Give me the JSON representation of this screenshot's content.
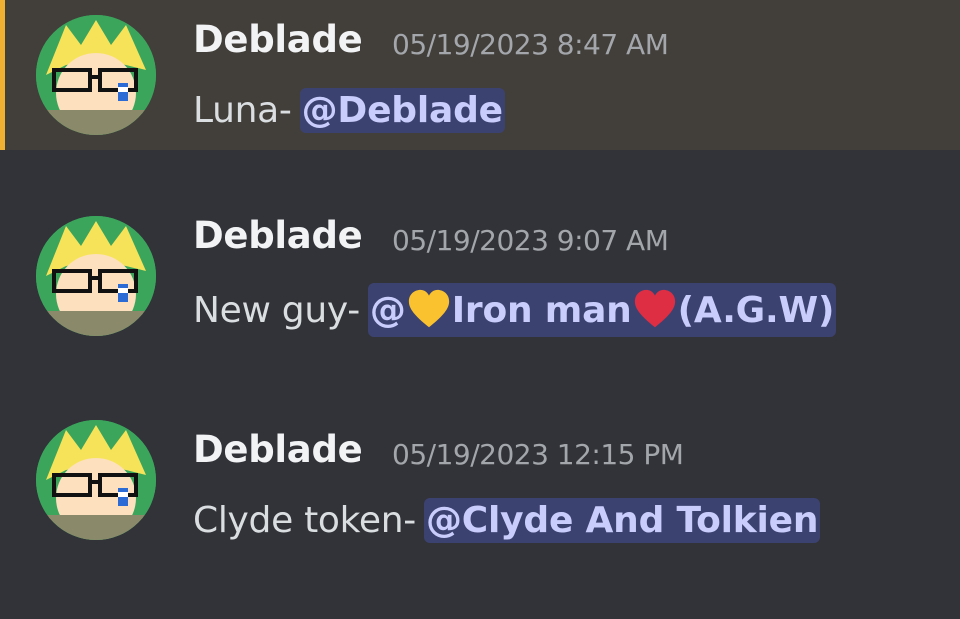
{
  "messages": [
    {
      "username": "Deblade",
      "timestamp": "05/19/2023 8:47 AM",
      "text": "Luna-",
      "mention": {
        "prefix": "@Deblade",
        "name": "",
        "suffix": ""
      },
      "highlighted": true
    },
    {
      "username": "Deblade",
      "timestamp": "05/19/2023 9:07 AM",
      "text": "New guy-",
      "mention": {
        "prefix": "@",
        "name": "Iron man",
        "suffix": "(A.G.W)",
        "emoji_before": "yellow-heart-icon",
        "emoji_after": "red-heart-icon"
      },
      "highlighted": false
    },
    {
      "username": "Deblade",
      "timestamp": "05/19/2023 12:15 PM",
      "text": "Clyde token-",
      "mention": {
        "prefix": "@Clyde And Tolkien",
        "name": "",
        "suffix": ""
      },
      "highlighted": false
    }
  ],
  "colors": {
    "background": "#313338",
    "highlight_bg": "#423f3a",
    "highlight_bar": "#f0b132",
    "mention_bg": "#3c4270",
    "mention_text": "#c9cdfb"
  }
}
